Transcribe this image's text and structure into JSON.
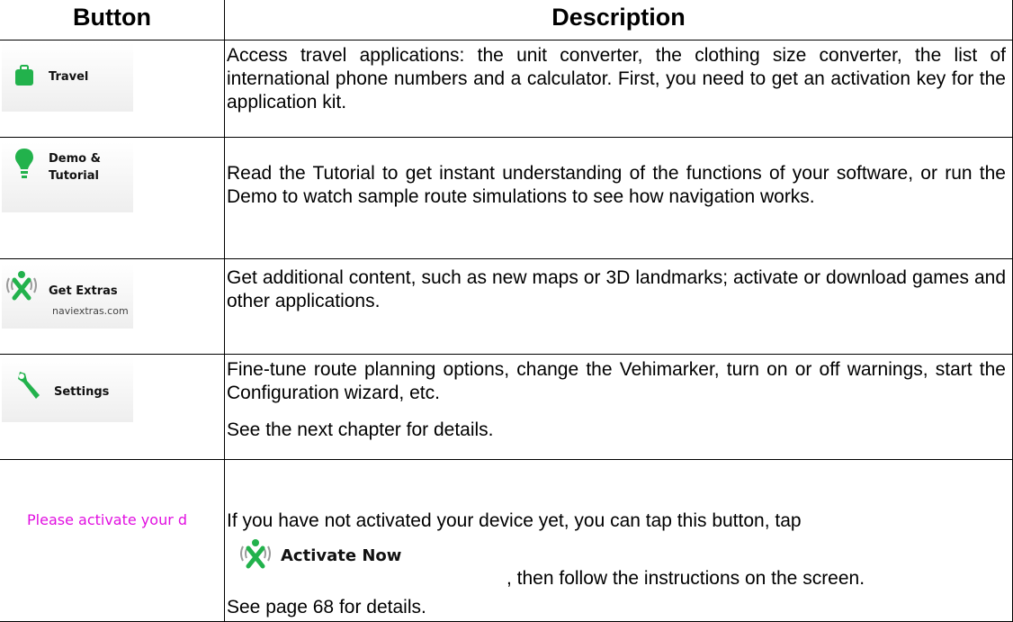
{
  "table": {
    "headers": {
      "button": "Button",
      "description": "Description"
    },
    "rows": [
      {
        "button_label_1": "Travel",
        "icon": "suitcase-icon",
        "description": "Access travel applications: the unit converter, the clothing size converter, the list of international phone numbers and a calculator. First, you need to get an activation key for the application kit."
      },
      {
        "button_label_1": "Demo &",
        "button_label_2": "Tutorial",
        "icon": "lightbulb-icon",
        "description": "Read the Tutorial to get instant understanding of the functions of your software, or run the Demo to watch sample route simulations to see how navigation works."
      },
      {
        "button_label_1": "Get Extras",
        "button_sublabel": "naviextras.com",
        "icon": "naviextras-icon",
        "description": "Get additional content, such as new maps or 3D landmarks; activate or download games and other applications."
      },
      {
        "button_label_1": "Settings",
        "icon": "wrench-icon",
        "description": "Fine-tune route planning options, change the Vehimarker, turn on or off warnings, start the Configuration wizard, etc.",
        "note": "See the next chapter for details."
      },
      {
        "button_label_1": "Please activate your d",
        "description": "If you have not activated your device yet, you can tap this button, tap",
        "inline_button": "Activate Now",
        "description_cont": ", then follow the instructions on the screen.",
        "note": "See page 68 for details."
      }
    ]
  },
  "colors": {
    "activate_text": "#e10fe0",
    "icon_green": "#22b24c",
    "icon_gray": "#9a9a9a"
  }
}
